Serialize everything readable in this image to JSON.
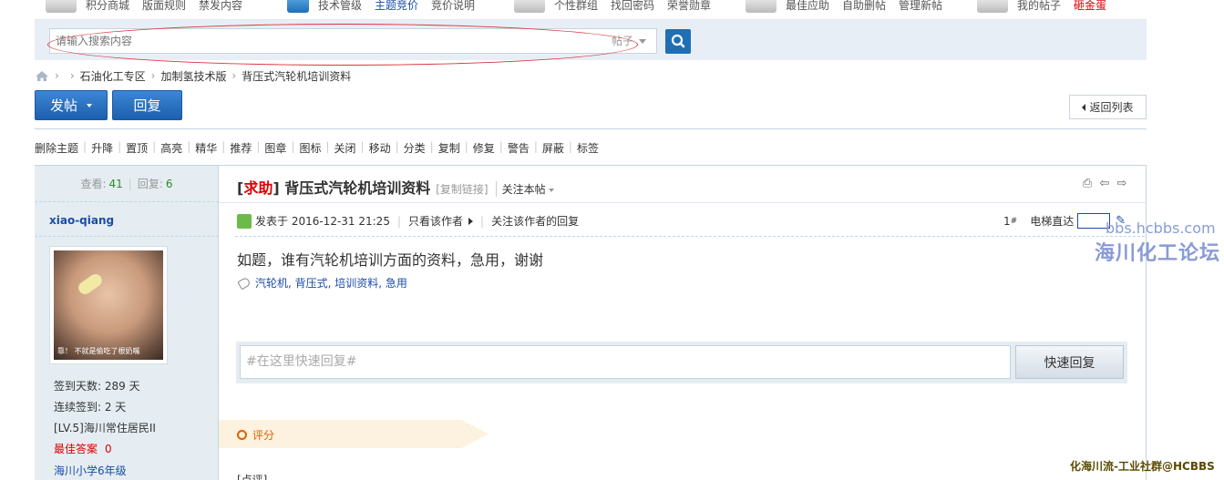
{
  "topnav": {
    "group1": [
      "积分商城",
      "版面规则",
      "禁发内容"
    ],
    "group2": [
      {
        "label": "技术管级",
        "style": ""
      },
      {
        "label": "主题竞价",
        "style": "blue"
      },
      {
        "label": "竞价说明",
        "style": ""
      }
    ],
    "group3": [
      "个性群组",
      "找回密码",
      "荣誉勋章"
    ],
    "group4": [
      "最佳应助",
      "自助删帖",
      "管理新帖"
    ],
    "group5": [
      {
        "label": "我的帖子",
        "style": ""
      },
      {
        "label": "砸金蛋",
        "style": "red"
      }
    ]
  },
  "search": {
    "placeholder": "请输入搜索内容",
    "type_label": "帖子"
  },
  "breadcrumb": [
    "石油化工专区",
    "加制氢技术版",
    "背压式汽轮机培训资料"
  ],
  "toolbar": {
    "post_label": "发帖",
    "reply_label": "回复",
    "back_label": "返回列表"
  },
  "mod_actions": [
    "删除主题",
    "升降",
    "置顶",
    "高亮",
    "精华",
    "推荐",
    "图章",
    "图标",
    "关闭",
    "移动",
    "分类",
    "复制",
    "修复",
    "警告",
    "屏蔽",
    "标签"
  ],
  "stats": {
    "views_label": "查看:",
    "views": "41",
    "replies_label": "回复:",
    "replies": "6"
  },
  "author": {
    "username": "xiao-qiang",
    "avatar_caption": "靠！ 不就是偷吃了根奶嘴",
    "signin_days": "签到天数: 289 天",
    "streak": "连续签到: 2 天",
    "level": "[LV.5]海川常住居民II",
    "best_answer_label": "最佳答案",
    "best_answer_value": "0",
    "grade": "海川小学6年级"
  },
  "thread": {
    "tag": "求助",
    "title": "背压式汽轮机培训资料",
    "copy_link": "[复制链接]",
    "follow_label": "关注本帖",
    "posted_at": "发表于 2016-12-31 21:25",
    "only_author": "只看该作者",
    "follow_author_replies": "关注该作者的回复",
    "floor_num": "1",
    "floor_mark": "#",
    "elevator_label": "电梯直达",
    "content": "如题，谁有汽轮机培训方面的资料，急用，谢谢",
    "tags_text": "汽轮机, 背压式, 培训资料, 急用"
  },
  "quick_reply": {
    "placeholder": "#在这里快速回复#",
    "button_label": "快速回复"
  },
  "rating": {
    "label": "评分"
  },
  "watermark": {
    "url": "bbs.hcbbs.com",
    "name": "海川化工论坛",
    "bottom": "化海川流-工业社群@HCBBS"
  },
  "partial_text": "[点评]   ...   ...   ..."
}
